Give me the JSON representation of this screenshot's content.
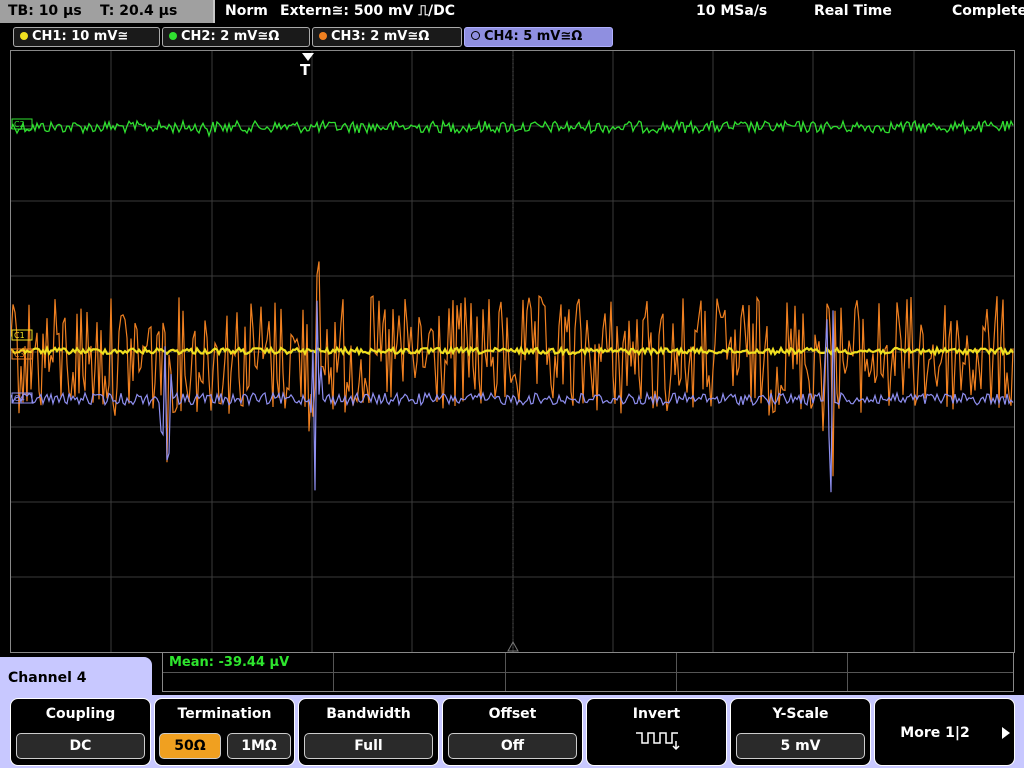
{
  "status": {
    "timebase": "TB: 10 µs",
    "trigger_time": "T: 20.4 µs",
    "trigger_mode": "Norm",
    "trigger_source": "Extern≅: 500 mV ⎍/DC",
    "sample_rate": "10 MSa/s",
    "acq_mode": "Real Time",
    "acq_state": "Complete"
  },
  "channels": [
    {
      "label": "CH1: 10 mV≅",
      "color": "#f0e020"
    },
    {
      "label": "CH2: 2 mV≅Ω",
      "color": "#30e030"
    },
    {
      "label": "CH3: 2 mV≅Ω",
      "color": "#f08020"
    },
    {
      "label": "CH4: 5 mV≅Ω",
      "color": "#8f8ff0"
    }
  ],
  "trigger_marker": "T",
  "trace_markers": {
    "ch2": "C2",
    "ch1": "C1",
    "ch3": "C3",
    "ch4": "C4"
  },
  "measurement": "Mean: -39.44 µV",
  "menu_title": "Channel 4",
  "softkeys": {
    "coupling": {
      "label": "Coupling",
      "value": "DC"
    },
    "termination": {
      "label": "Termination",
      "value_a": "50Ω",
      "value_b": "1MΩ"
    },
    "bandwidth": {
      "label": "Bandwidth",
      "value": "Full"
    },
    "offset": {
      "label": "Offset",
      "value": "Off"
    },
    "invert": {
      "label": "Invert",
      "icon": "invert-waveform-icon"
    },
    "yscale": {
      "label": "Y-Scale",
      "value": "5 mV"
    },
    "more": {
      "label": "More 1|2",
      "icon": "arrow-right-icon"
    }
  }
}
